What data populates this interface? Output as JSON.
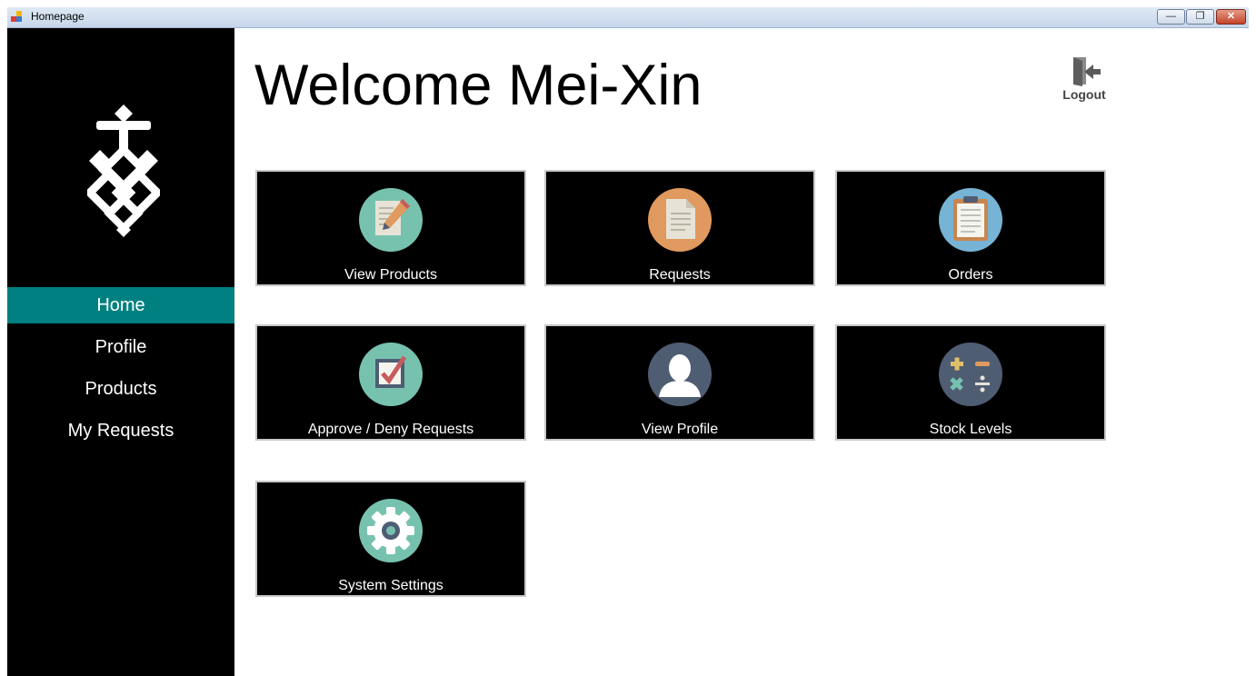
{
  "window": {
    "title": "Homepage",
    "minimize_glyph": "—",
    "restore_glyph": "❐",
    "close_glyph": "✕"
  },
  "sidebar": {
    "logo_icon": "knot-logo-icon",
    "items": [
      {
        "label": "Home",
        "active": true
      },
      {
        "label": "Profile",
        "active": false
      },
      {
        "label": "Products",
        "active": false
      },
      {
        "label": "My Requests",
        "active": false
      }
    ],
    "active_color": "#008080"
  },
  "header": {
    "welcome": "Welcome Mei-Xin",
    "logout_label": "Logout",
    "logout_icon": "logout-door-icon"
  },
  "tiles": [
    {
      "label": "View Products",
      "icon": "edit-document-icon",
      "color": "#76c2af"
    },
    {
      "label": "Requests",
      "icon": "document-icon",
      "color": "#e0995e"
    },
    {
      "label": "Orders",
      "icon": "clipboard-icon",
      "color": "#77b3d4"
    },
    {
      "label": "Approve / Deny Requests",
      "icon": "checkbox-icon",
      "color": "#76c2af"
    },
    {
      "label": "View Profile",
      "icon": "user-icon",
      "color": "#4f5d73"
    },
    {
      "label": "Stock Levels",
      "icon": "calculator-icon",
      "color": "#4f5d73"
    },
    {
      "label": "System Settings",
      "icon": "gear-icon",
      "color": "#76c2af"
    }
  ]
}
